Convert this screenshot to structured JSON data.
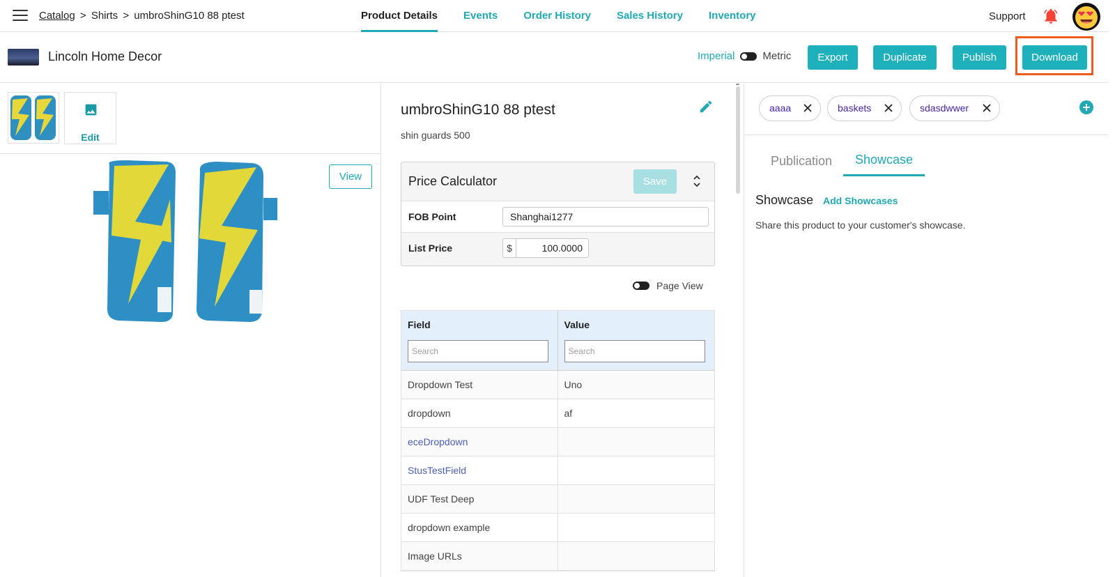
{
  "nav": {
    "breadcrumb": [
      "Catalog",
      "Shirts",
      "umbroShinG10 88 ptest"
    ],
    "breadcrumb_sep": ">",
    "tabs": [
      "Product Details",
      "Events",
      "Order History",
      "Sales History",
      "Inventory"
    ],
    "active_tab": "Product Details",
    "support": "Support"
  },
  "header": {
    "company": "Lincoln Home Decor",
    "unit_imperial": "Imperial",
    "unit_metric": "Metric",
    "buttons": {
      "export": "Export",
      "duplicate": "Duplicate",
      "publish": "Publish",
      "download": "Download"
    }
  },
  "gallery": {
    "edit": "Edit",
    "view": "View"
  },
  "product": {
    "title": "umbroShinG10 88 ptest",
    "subtitle": "shin guards 500"
  },
  "price_calculator": {
    "title": "Price Calculator",
    "save": "Save",
    "fob_label": "FOB Point",
    "fob_value": "Shanghai1277",
    "list_price_label": "List Price",
    "currency": "$",
    "list_price_value": "100.0000"
  },
  "page_view": "Page View",
  "field_table": {
    "headers": [
      "Field",
      "Value"
    ],
    "search_placeholder": "Search",
    "rows": [
      {
        "field": "Dropdown Test",
        "value": "Uno"
      },
      {
        "field": "dropdown",
        "value": "af"
      },
      {
        "field": "eceDropdown",
        "value": ""
      },
      {
        "field": "StusTestField",
        "value": ""
      },
      {
        "field": "UDF Test Deep",
        "value": ""
      },
      {
        "field": "dropdown example",
        "value": ""
      },
      {
        "field": "Image URLs",
        "value": ""
      }
    ]
  },
  "tags": [
    "aaaa",
    "baskets",
    "sdasdwwer"
  ],
  "right_tabs": {
    "publication": "Publication",
    "showcase": "Showcase"
  },
  "showcase": {
    "title": "Showcase",
    "add": "Add Showcases",
    "description": "Share this product to your customer's showcase."
  },
  "colors": {
    "accent": "#20a9b5",
    "highlight": "#f05a1a",
    "tag_text": "#4527a0",
    "bell": "#f44336"
  }
}
